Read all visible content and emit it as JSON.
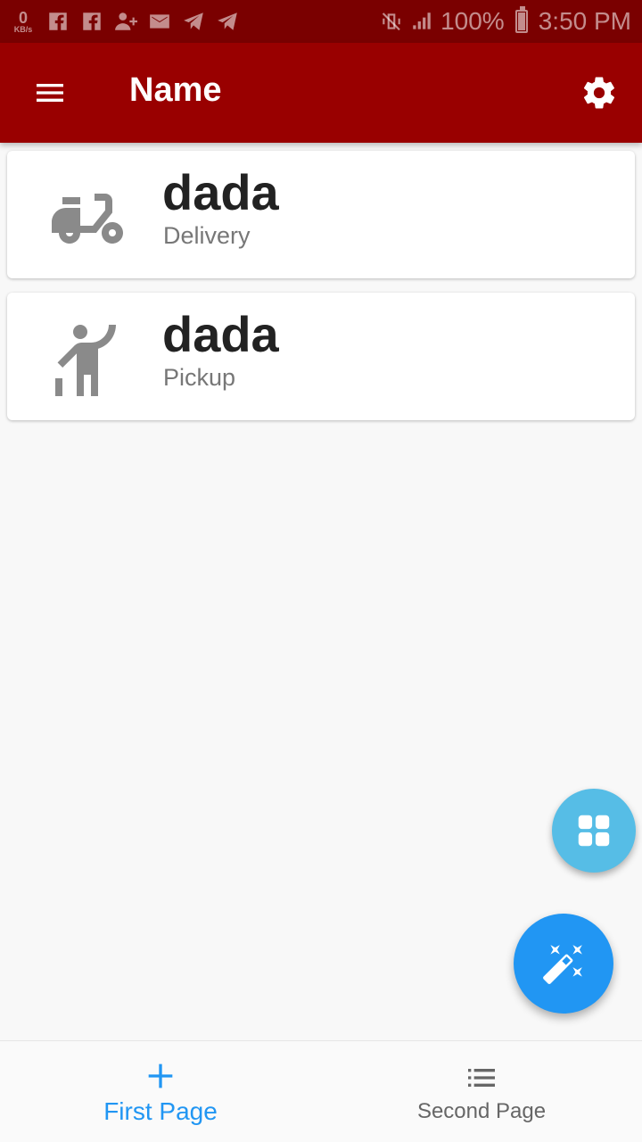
{
  "status_bar": {
    "speed_value": "0",
    "speed_unit": "KB/s",
    "battery": "100%",
    "time": "3:50 PM",
    "icons": [
      "facebook-icon",
      "facebook-icon",
      "add-user-icon",
      "mail-icon",
      "telegram-icon",
      "telegram-icon",
      "vibrate-icon",
      "signal-icon",
      "battery-icon"
    ]
  },
  "app_bar": {
    "title": "Name",
    "menu_icon": "menu-icon",
    "settings_icon": "gear-icon",
    "color": "#990000"
  },
  "cards": [
    {
      "title": "dada",
      "subtitle": "Delivery",
      "icon": "scooter-icon"
    },
    {
      "title": "dada",
      "subtitle": "Pickup",
      "icon": "person-waving-icon"
    }
  ],
  "fabs": {
    "small": {
      "icon": "grid-icon",
      "color": "#56bde6"
    },
    "main": {
      "icon": "magic-wand-icon",
      "color": "#2196f3"
    }
  },
  "bottom_nav": {
    "items": [
      {
        "label": "First Page",
        "icon": "plus-icon",
        "active": true
      },
      {
        "label": "Second Page",
        "icon": "list-icon",
        "active": false
      }
    ],
    "active_color": "#2196f3"
  }
}
